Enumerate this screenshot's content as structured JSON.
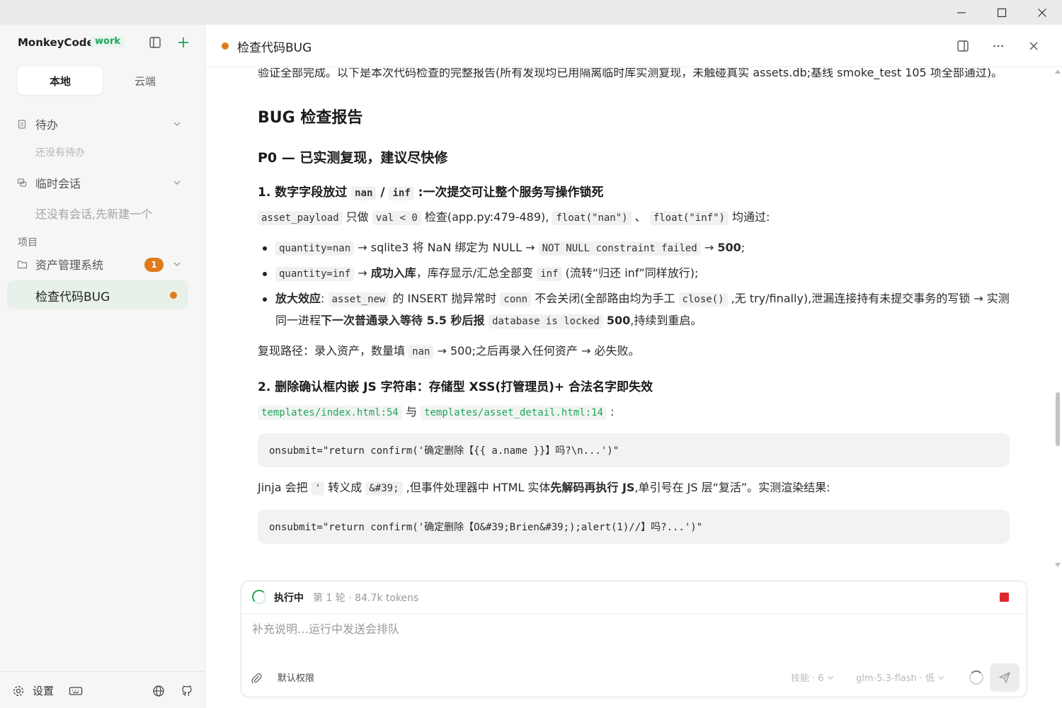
{
  "app": {
    "brand": "MonkeyCode",
    "brand_tag": "work"
  },
  "sidebar": {
    "tabs": [
      "本地",
      "云端"
    ],
    "todo": {
      "title": "待办",
      "empty": "还没有待办"
    },
    "temp": {
      "title": "临时会话",
      "empty": "还没有会话,先新建一个"
    },
    "project_label": "项目",
    "project": {
      "name": "资产管理系统",
      "badge": "1"
    },
    "active_item": "检查代码BUG",
    "footer": {
      "settings_label": "设置"
    }
  },
  "header": {
    "title": "检查代码BUG"
  },
  "content": {
    "intro": "验证全部完成。以下是本次代码检查的完整报告(所有发现均已用隔离临时库实测复现，未触碰真实 assets.db;基线 smoke_test 105 项全部通过)。",
    "h1": "BUG 检查报告",
    "h2": "P0 — 已实测复现，建议尽快修",
    "item1": {
      "title_pre": "1. 数字字段放过 ",
      "code_a": "nan",
      "slash": " / ",
      "code_b": "inf",
      "title_post": " :一次提交可让整个服务写操作锁死",
      "desc": {
        "c1": "asset_payload",
        "t1": " 只做 ",
        "c2": "val < 0",
        "t2": " 检查(app.py:479-489), ",
        "c3": "float(\"nan\")",
        "t3": " 、 ",
        "c4": "float(\"inf\")",
        "t4": " 均通过:"
      },
      "bullets": {
        "b1_code1": "quantity=nan",
        "b1_t1": " → sqlite3 将 NaN 绑定为 NULL → ",
        "b1_code2": "NOT NULL constraint failed",
        "b1_t2": " → ",
        "b1_bold": "500",
        "b1_t3": ";",
        "b2_code1": "quantity=inf",
        "b2_t1": " → ",
        "b2_bold": "成功入库",
        "b2_t2": "，库存显示/汇总全部变 ",
        "b2_code2": "inf",
        "b2_t3": " (流转“归还 inf”同样放行);",
        "b3_bold1": "放大效应",
        "b3_t1": ": ",
        "b3_code1": "asset_new",
        "b3_t2": " 的 INSERT 抛异常时 ",
        "b3_code2": "conn",
        "b3_t3": " 不会关闭(全部路由均为手工 ",
        "b3_code3": "close()",
        "b3_t4": " ,无 try/finally),泄漏连接持有未提交事务的写锁 → 实测同一进程",
        "b3_bold2": "下一次普通录入等待 5.5 秒后报 ",
        "b3_code4": "database is locked",
        "b3_t5": " ",
        "b3_bold3": "500",
        "b3_t6": ",持续到重启。"
      },
      "repro_pre": "复现路径：录入资产，数量填 ",
      "repro_code": "nan",
      "repro_post": " → 500;之后再录入任何资产 → 必失败。"
    },
    "item2": {
      "title": "2. 删除确认框内嵌 JS 字符串：存储型 XSS(打管理员)+ 合法名字即失效",
      "file1": "templates/index.html:54",
      "and": " 与 ",
      "file2": "templates/asset_detail.html:14",
      "colon": " :",
      "code1": "onsubmit=\"return confirm('确定删除【{{ a.name }}】吗?\\n...')\"",
      "jinja_pre": "Jinja 会把 ",
      "jinja_c1": "'",
      "jinja_t1": " 转义成 ",
      "jinja_c2": "&#39;",
      "jinja_t2": " ,但事件处理器中 HTML 实体",
      "jinja_bold": "先解码再执行 JS",
      "jinja_t3": ",单引号在 JS 层“复活”。实测渲染结果:",
      "code2": "onsubmit=\"return confirm('确定删除【O&#39;Brien&#39;);alert(1)//】吗?...')\""
    }
  },
  "composer": {
    "status": "执行中",
    "meta": "第 1 轮 · 84.7k tokens",
    "placeholder": "补充说明…运行中发送会排队",
    "permission": "默认权限",
    "skills": "技能 · 6",
    "model": "glm-5.3-flash · 低"
  }
}
